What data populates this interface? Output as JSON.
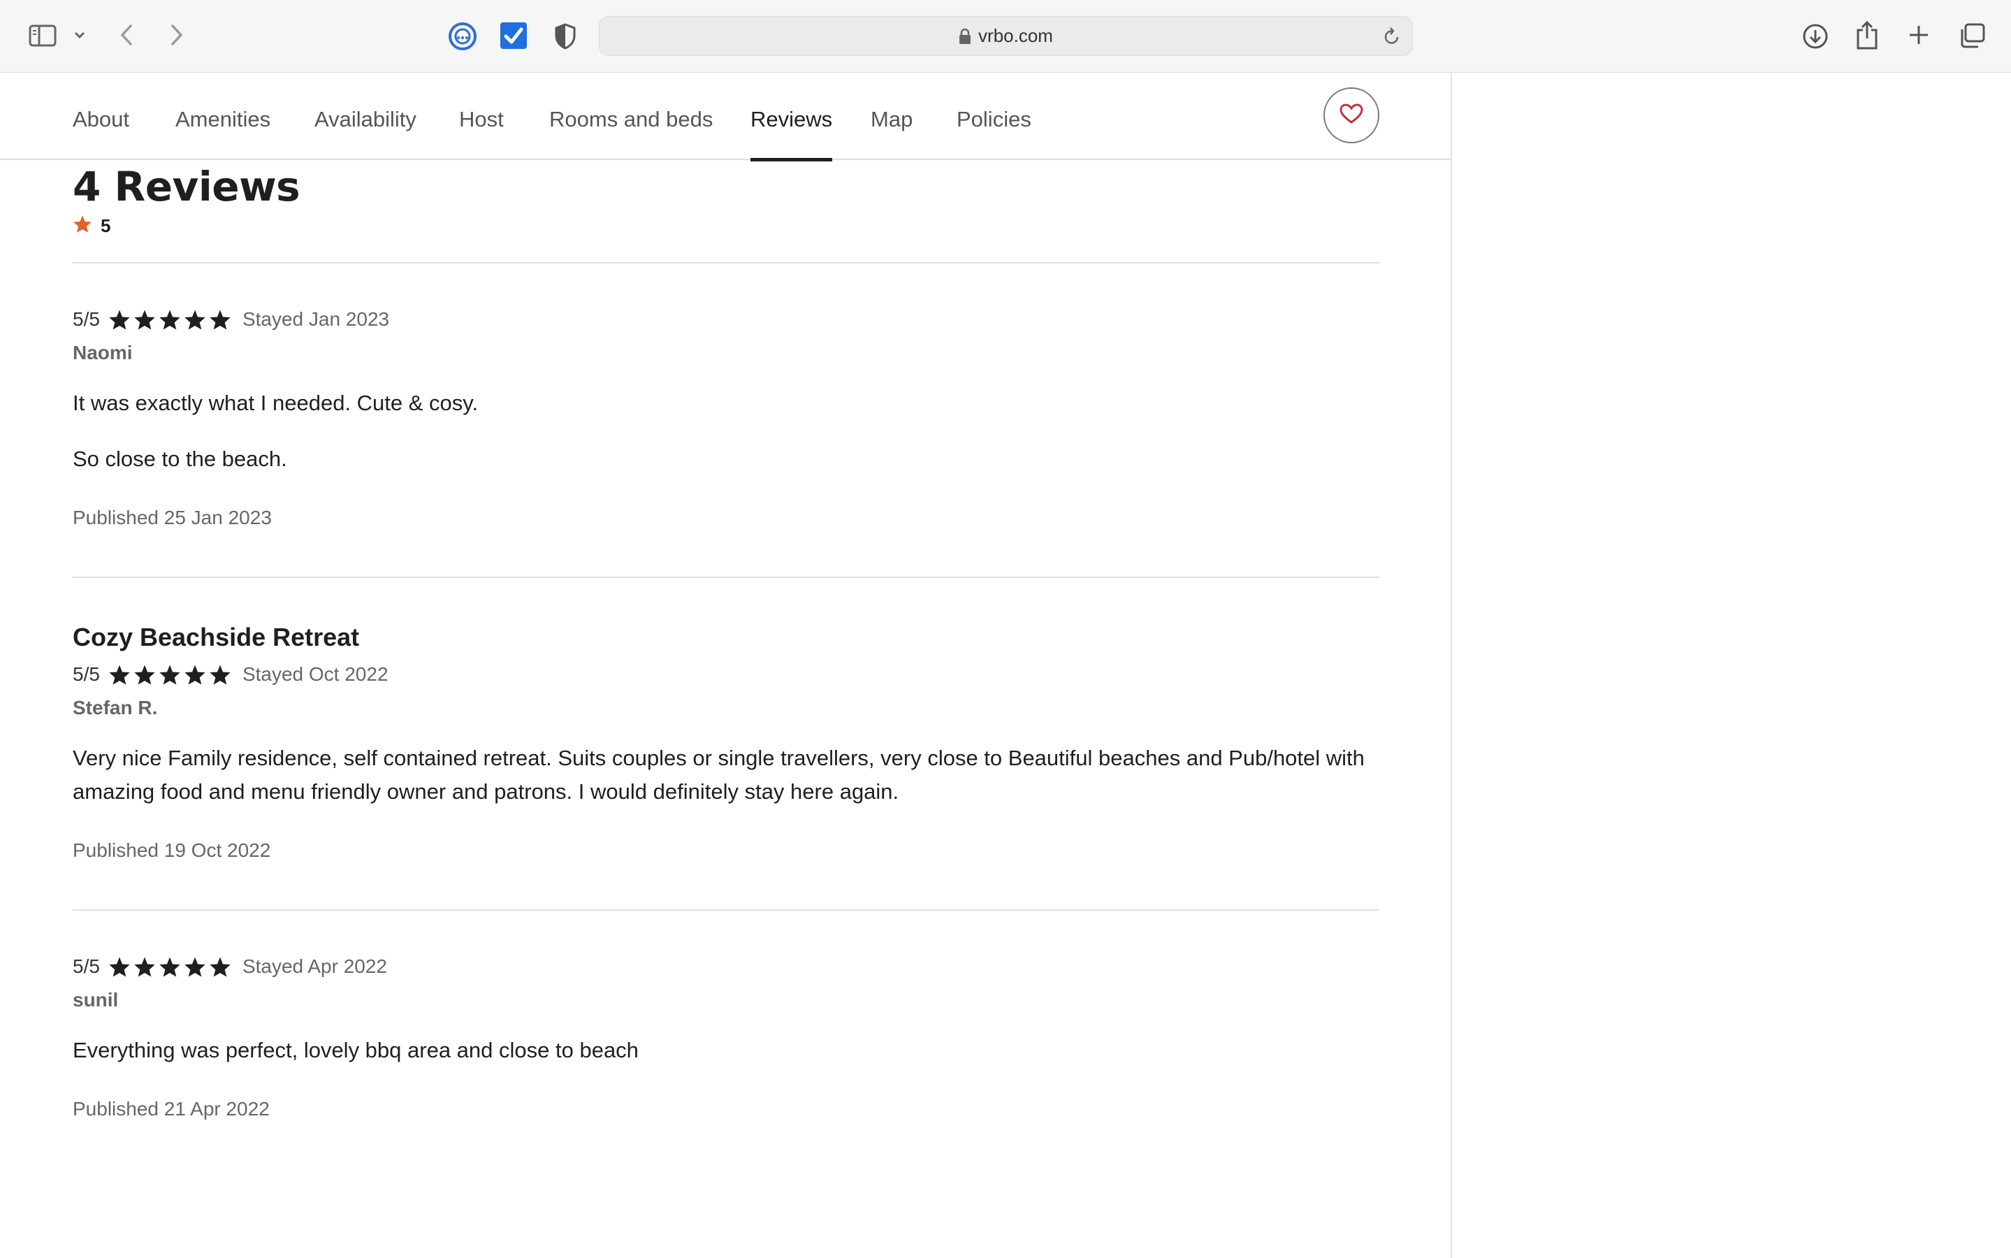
{
  "browser": {
    "url": "vrbo.com"
  },
  "nav": {
    "tabs": [
      "About",
      "Amenities",
      "Availability",
      "Host",
      "Rooms and beds",
      "Reviews",
      "Map",
      "Policies"
    ],
    "active_tab": "Reviews"
  },
  "reviews_section": {
    "heading": "4 Reviews",
    "overall_rating": "5"
  },
  "reviews": [
    {
      "title": "",
      "score": "5/5",
      "stars": 5,
      "stayed": "Stayed Jan 2023",
      "author": "Naomi",
      "paragraphs": [
        "It was exactly what I needed. Cute & cosy.",
        "So close to the beach."
      ],
      "published": "Published 25 Jan 2023"
    },
    {
      "title": "Cozy Beachside Retreat",
      "score": "5/5",
      "stars": 5,
      "stayed": "Stayed Oct 2022",
      "author": "Stefan R.",
      "paragraphs": [
        "Very nice Family residence, self contained retreat. Suits couples or single travellers, very close to Beautiful beaches and Pub/hotel with amazing food and menu friendly owner and patrons. I would definitely stay here again."
      ],
      "published": "Published 19 Oct 2022"
    },
    {
      "title": "",
      "score": "5/5",
      "stars": 5,
      "stayed": "Stayed Apr 2022",
      "author": "sunil",
      "paragraphs": [
        "Everything was perfect, lovely bbq area and close to beach"
      ],
      "published": "Published 21 Apr 2022"
    }
  ],
  "colors": {
    "accent_star": "#e2612e",
    "heart": "#c4323d",
    "active_tab": "#1f1f1f"
  }
}
